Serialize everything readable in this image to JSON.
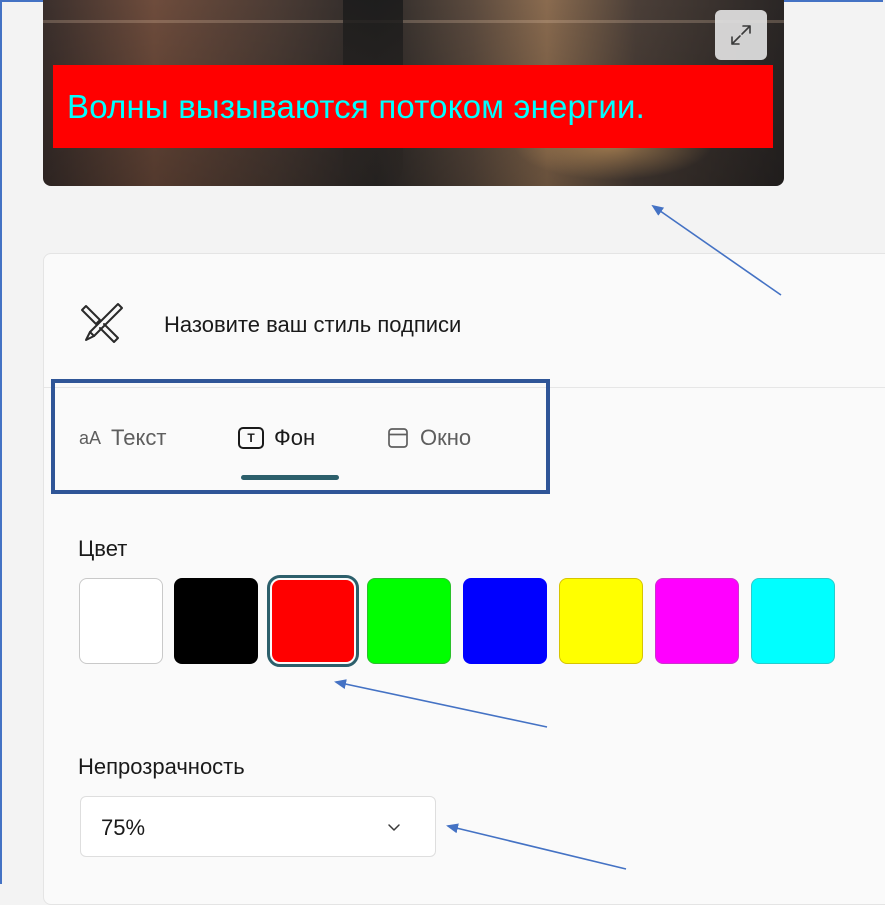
{
  "preview": {
    "caption": "Волны вызываются потоком энергии.",
    "caption_background_color": "#ff0000",
    "caption_text_color": "#00ffff",
    "expand_icon": "expand-icon"
  },
  "style_card": {
    "title": "Назовите ваш стиль подписи",
    "title_icon": "pen-icon",
    "tabs": [
      {
        "icon_text": "aA",
        "label": "Текст",
        "active": false
      },
      {
        "icon_text": "T",
        "label": "Фон",
        "active": true
      },
      {
        "icon_text": "",
        "label": "Окно",
        "active": false
      }
    ]
  },
  "color_section": {
    "label": "Цвет",
    "swatches": [
      {
        "name": "white",
        "color": "#ffffff"
      },
      {
        "name": "black",
        "color": "#000000"
      },
      {
        "name": "red",
        "color": "#ff0000",
        "selected": true
      },
      {
        "name": "green",
        "color": "#00ff00"
      },
      {
        "name": "blue",
        "color": "#0000ff"
      },
      {
        "name": "yellow",
        "color": "#ffff00"
      },
      {
        "name": "magenta",
        "color": "#ff00ff"
      },
      {
        "name": "cyan",
        "color": "#00ffff"
      }
    ]
  },
  "opacity_section": {
    "label": "Непрозрачность",
    "selected_value": "75%",
    "chevron_icon": "chevron-down-icon"
  },
  "annotation_color": "#4472c4"
}
